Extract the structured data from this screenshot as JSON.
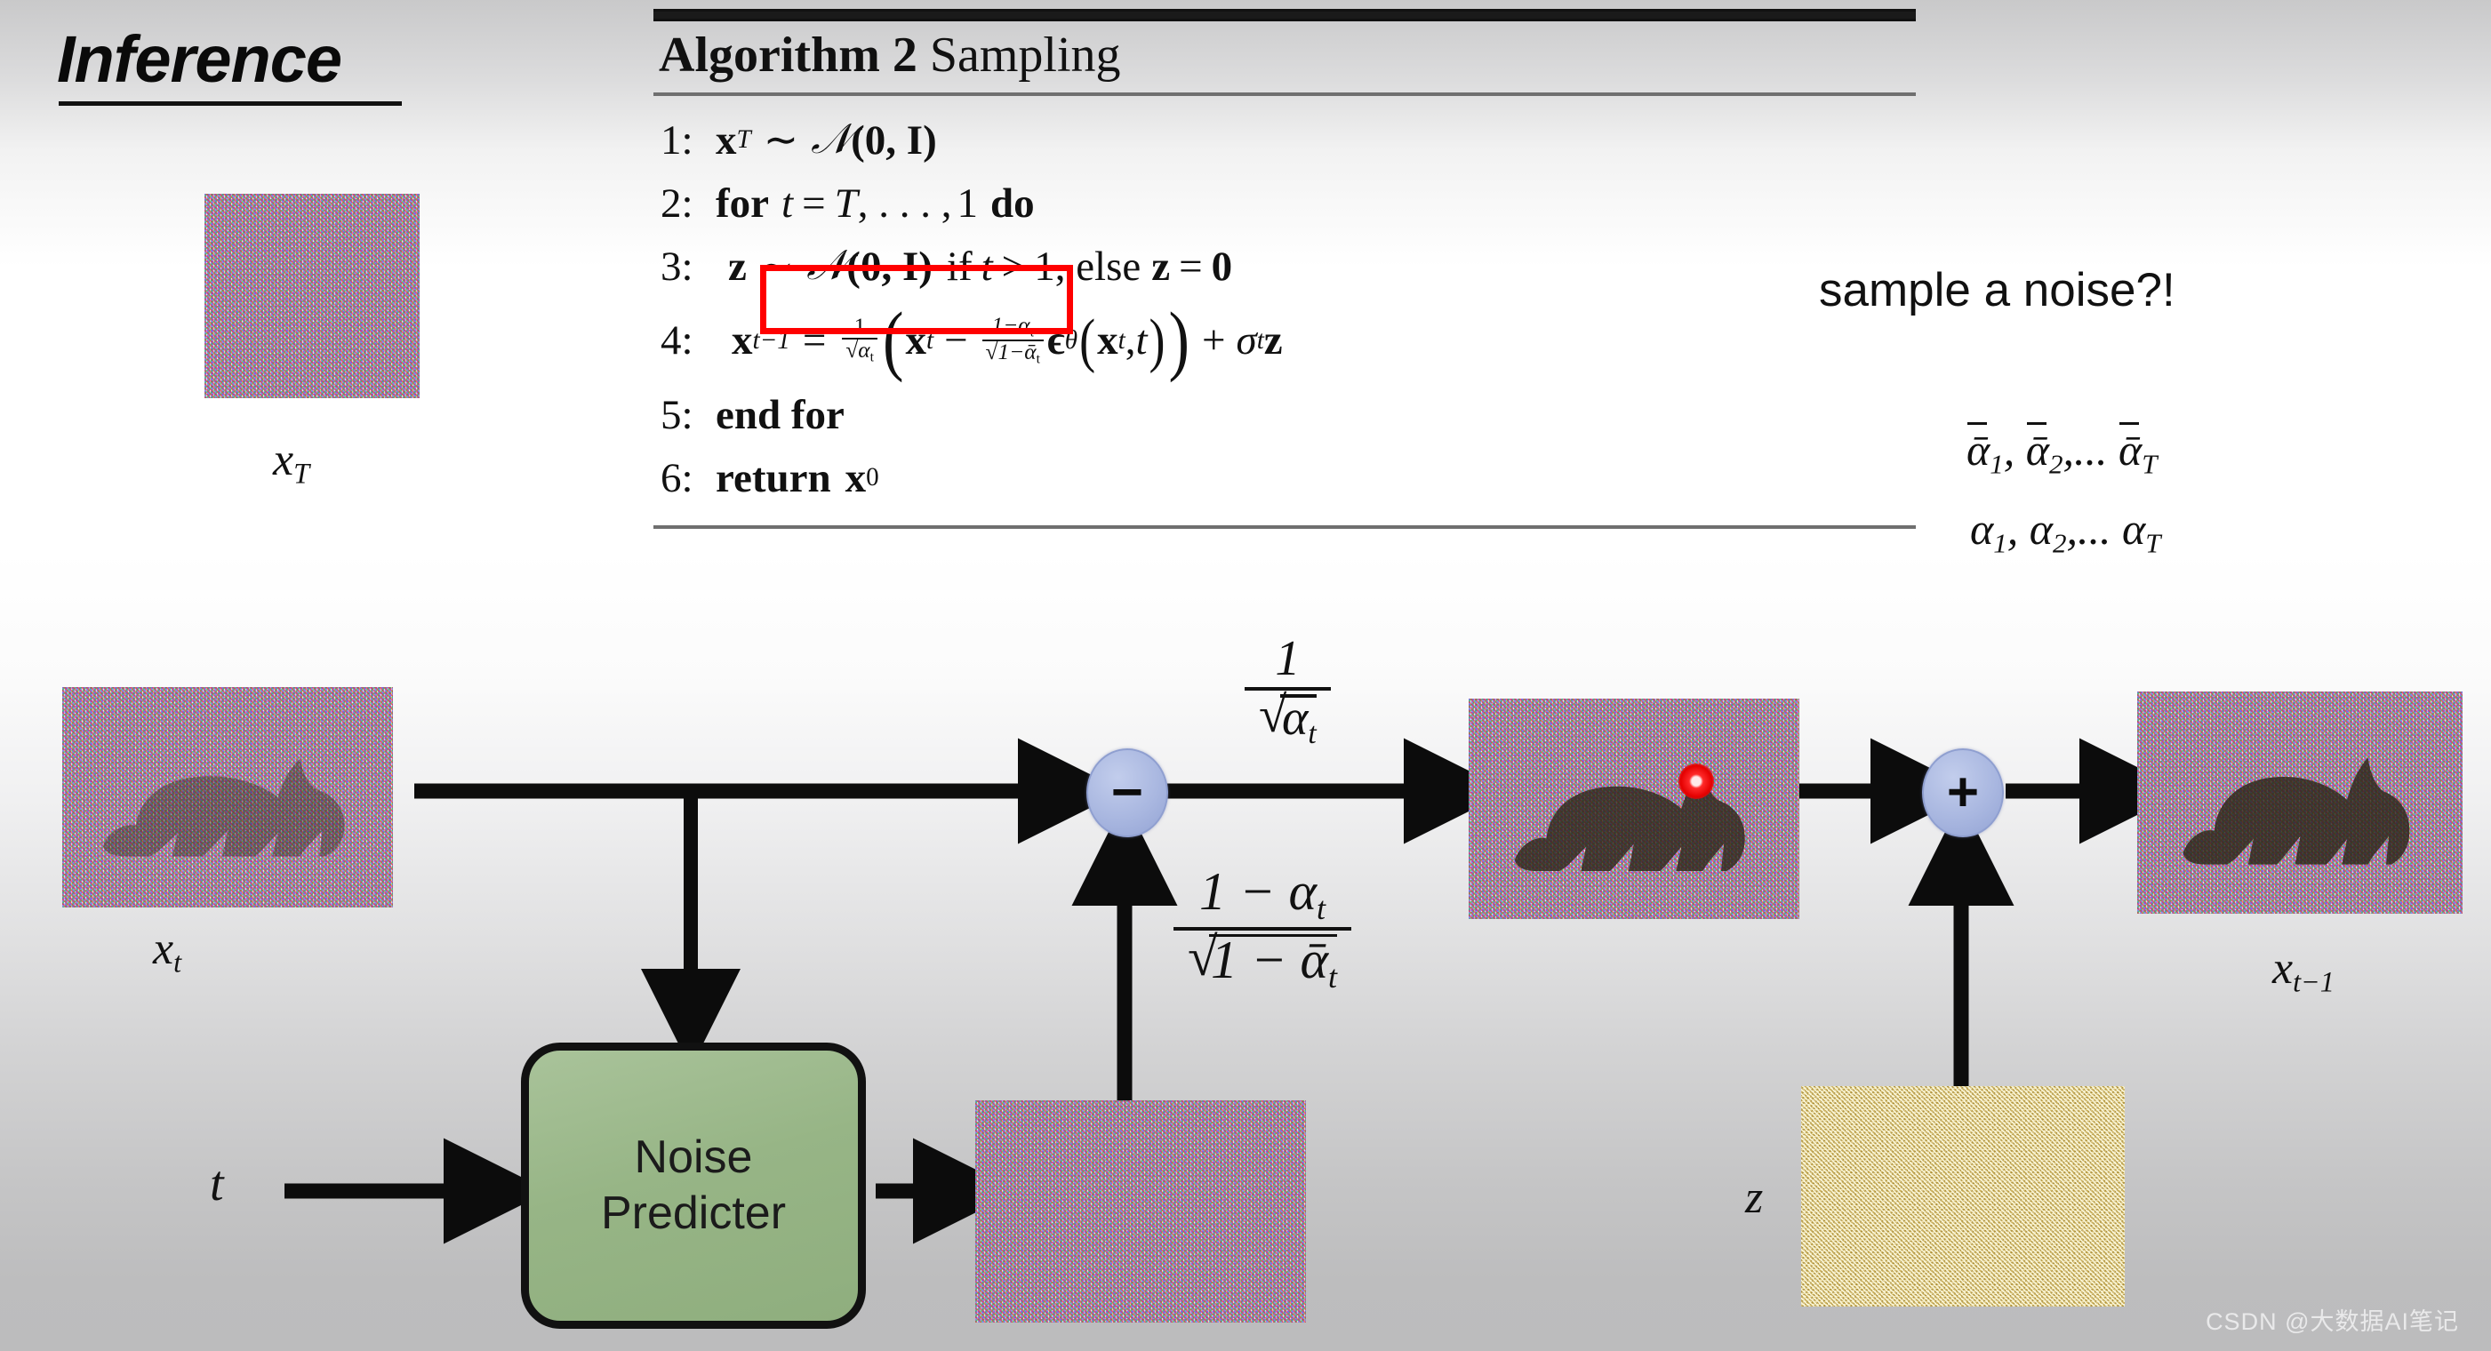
{
  "slide": {
    "title": "Inference",
    "background_top_color": "#c9c9ca",
    "background_mid_color": "#ffffff",
    "background_bottom_color": "#bcbcbd"
  },
  "algorithm": {
    "caption_bold": "Algorithm 2",
    "caption_rest": "Sampling",
    "lines": [
      {
        "num": "1:",
        "text": "x_T ~ N(0, I)"
      },
      {
        "num": "2:",
        "text": "for t = T, . . . , 1 do"
      },
      {
        "num": "3:",
        "text": "z ~ N(0, I) if t > 1, else z = 0"
      },
      {
        "num": "4:",
        "text": "x_{t-1} = 1/sqrt(alpha_t) ( x_t - (1-alpha_t)/sqrt(1-alphabar_t) eps_theta(x_t, t) ) + sigma_t z"
      },
      {
        "num": "5:",
        "text": "end for"
      },
      {
        "num": "6:",
        "text": "return x_0"
      }
    ],
    "line1": {
      "num": "1:",
      "x": "x",
      "xsub": "T",
      "sim": "∼",
      "dist": "𝒩",
      "args": "(0, I)"
    },
    "line2": {
      "num": "2:",
      "for": "for",
      "t": "t",
      "eq": "=",
      "T": "T",
      "dots": ", . . . ,",
      "one": "1",
      "do": "do"
    },
    "line3": {
      "num": "3:",
      "z": "z",
      "sim": "∼",
      "dist": "𝒩",
      "args": "(0, I)",
      "cond": "if",
      "t": "t",
      "gt": ">",
      "one": "1",
      "else": ", else",
      "z2": "z",
      "eq": "=",
      "zero": "0"
    },
    "line4": {
      "num": "4:",
      "lhs": "x",
      "lhssub": "t−1",
      "eq": "=",
      "frac1_num": "1",
      "frac1_den": "√α",
      "frac1_den_sub": "t",
      "open": "(",
      "xt": "x",
      "xtsub": "t",
      "minus": "−",
      "frac2_num": "1−α",
      "frac2_num_sub": "t",
      "frac2_den": "√1−ᾱ",
      "frac2_den_sub": "t",
      "eps": "ϵ",
      "epssub": "θ",
      "epsargs_open": "(",
      "epsx": "x",
      "epsxsub": "t",
      "comma": ", ",
      "epst": "t",
      "epsargs_close": ")",
      "close": ")",
      "plus": "+",
      "sigma": "σ",
      "sigmasub": "t",
      "zz": "z"
    },
    "line5": {
      "num": "5:",
      "text": "end for"
    },
    "line6": {
      "num": "6:",
      "text": "return",
      "x": "x",
      "xsub": "0"
    },
    "highlight_box_color": "#ff0000",
    "highlight_target": "z ~ N(0, I)"
  },
  "annotations": {
    "sample_note": "sample a noise?!",
    "alpha_bar_sequence": {
      "a1": "ᾱ",
      "s1": "1",
      "sep1": ", ",
      "a2": "ᾱ",
      "s2": "2",
      "sep2": ",... ",
      "a3": "ᾱ",
      "s3": "T"
    },
    "alpha_sequence": {
      "a1": "α",
      "s1": "1",
      "sep1": ", ",
      "a2": "α",
      "s2": "2",
      "sep2": ",... ",
      "a3": "α",
      "s3": "T"
    },
    "alpha_bar_plain": "ᾱ1, ᾱ2,... ᾱT",
    "alpha_plain": "α1, α2,... αT"
  },
  "diagram": {
    "tiles": {
      "xT": {
        "label_base": "x",
        "label_sub": "T",
        "kind": "noise-rgb"
      },
      "xt": {
        "label_base": "x",
        "label_sub": "t",
        "kind": "noise-rgb-cat"
      },
      "predicted_noise": {
        "label_base": "",
        "label_sub": "",
        "kind": "noise-rgb"
      },
      "mid_cat": {
        "label_base": "",
        "label_sub": "",
        "kind": "noise-rgb-cat"
      },
      "z_noise": {
        "label_base": "z",
        "label_sub": "",
        "kind": "noise-gold"
      },
      "xt_minus_1": {
        "label_base": "x",
        "label_sub": "t−1",
        "kind": "noise-rgb-cat"
      }
    },
    "noise_predicter": {
      "line1": "Noise",
      "line2": "Predicter",
      "fill_color": "#97b586",
      "border_color": "#111111"
    },
    "t_input_label": "t",
    "operators": {
      "minus": {
        "glyph": "−",
        "fill_color": "#a9b7e0"
      },
      "plus": {
        "glyph": "+",
        "fill_color": "#a9b7e0"
      }
    },
    "scale_fraction": {
      "num": "1",
      "den_root": "α",
      "den_sub": "t"
    },
    "noise_fraction": {
      "num_a": "1 − α",
      "num_sub": "t",
      "den_root": "1 − ᾱ",
      "den_sub": "t"
    },
    "laser_dot_color": "#ff2a2a"
  },
  "watermark": {
    "text": "CSDN @大数据AI笔记"
  }
}
